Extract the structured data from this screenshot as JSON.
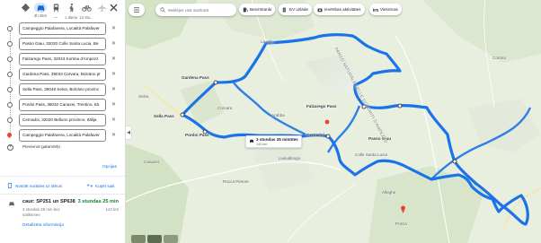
{
  "modes": [
    {
      "name": "best",
      "label": ""
    },
    {
      "name": "car",
      "label": "3h 25m"
    },
    {
      "name": "transit",
      "label": "—"
    },
    {
      "name": "walk",
      "label": "1 diena"
    },
    {
      "name": "bike",
      "label": "12 stu..."
    },
    {
      "name": "flight",
      "label": ""
    }
  ],
  "stops": [
    "Campeggio Palafavera, Località Palafaver",
    "Passo Giau, 32020 Colle Santa Lucia, Be",
    "Falzarego Pass, 32043 Kortina d'Ampezz",
    "Gardena Pass, 39033 Corvara, Bolcāno pr",
    "Sella Pass, 39048 Selva, Bolcāno provinc",
    "Pordoi Pass, 38032 Canazei, Trentino, Itā",
    "Cernadoi, 32020 Belluno province, Itālija",
    "Campeggio Palafavera, Località Palafaver"
  ],
  "add_destination": "Pievienot galamērķi",
  "options": "Opcijas",
  "send": {
    "phone": "Nosūtīt norādes uz tālruni",
    "copy": "Kopēt saiti"
  },
  "route": {
    "via": "caur: SP251 un SP638",
    "time": "3 stundas 25 min",
    "subtitle": "3 stundas 25 min bez satiksmes",
    "distance": "142 km",
    "details": "Detalizēta informācija"
  },
  "map": {
    "search_placeholder": "Meklējiet visā maršrutā",
    "chips": [
      "Benzīntanki",
      "EV uzlāde",
      "Ievērības aktivitātes",
      "Viesnīcas"
    ],
    "places": {
      "gardena": "Gardena Pass",
      "sella": "Sella Pass",
      "pordoi": "Pordoi Pass",
      "falzarego": "Falzarego Pass",
      "cernadoi": "Cernadoi",
      "giau": "Passo Giau",
      "la_villa": "La Villa",
      "arabba": "Arabba",
      "corvara": "Corvara",
      "colle": "Colle Santa Lucia",
      "selva": "Selva",
      "canazei": "Canazei",
      "livinallongo": "Livinallongo",
      "cortina": "Cortina",
      "park": "PARCO NATURALE DELLE DOLOMITI D'AMPEZZO",
      "alleghe": "Alleghe",
      "rocca": "Rocca Pietore",
      "pozza": "Pozza"
    },
    "bubble": {
      "time": "3 stundas 25 minūtes",
      "dist": "142 km"
    }
  },
  "colors": {
    "route": "#1a73e8",
    "accent": "#1a73e8",
    "green": "#188038"
  }
}
